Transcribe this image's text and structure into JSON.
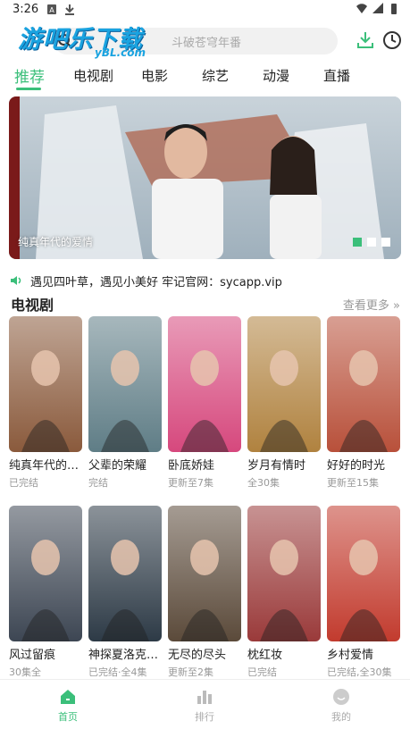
{
  "status_bar": {
    "time": "3:26"
  },
  "header": {
    "logo_text": "游吧乐下载",
    "logo_sub": "yBL.com",
    "search_placeholder": "斗破苍穹年番"
  },
  "tabs": [
    {
      "label": "推荐",
      "active": true
    },
    {
      "label": "电视剧"
    },
    {
      "label": "电影"
    },
    {
      "label": "综艺"
    },
    {
      "label": "动漫"
    },
    {
      "label": "直播"
    }
  ],
  "banner": {
    "caption": "纯真年代的爱情",
    "slide_count": 3,
    "active_slide": 1
  },
  "notice": {
    "text": "遇见四叶草，遇见小美好 牢记官网：sycapp.vip"
  },
  "section": {
    "title": "电视剧",
    "more_label": "查看更多"
  },
  "cards": [
    {
      "title": "纯真年代的爱情",
      "status": "已完结",
      "color": "#8a5a3c"
    },
    {
      "title": "父辈的荣耀",
      "status": "完结",
      "color": "#5f7d86"
    },
    {
      "title": "卧底娇娃",
      "status": "更新至7集",
      "color": "#d6487d"
    },
    {
      "title": "岁月有情时",
      "status": "全30集",
      "color": "#b0823f"
    },
    {
      "title": "好好的时光",
      "status": "更新至15集",
      "color": "#b8503a"
    },
    {
      "title": "风过留痕",
      "status": "30集全",
      "color": "#3d4653"
    },
    {
      "title": "神探夏洛克第一季",
      "status": "已完结·全4集",
      "color": "#2d3a46"
    },
    {
      "title": "无尽的尽头",
      "status": "更新至2集",
      "color": "#5b4a3a"
    },
    {
      "title": "枕红妆",
      "status": "已完结",
      "color": "#9a3a3a"
    },
    {
      "title": "乡村爱情",
      "status": "已完结,全30集",
      "color": "#c23b2e"
    }
  ],
  "bottom_nav": [
    {
      "label": "首页",
      "icon": "home-icon",
      "active": true
    },
    {
      "label": "排行",
      "icon": "ranking-icon"
    },
    {
      "label": "我的",
      "icon": "profile-icon"
    }
  ],
  "colors": {
    "accent": "#3bbf7a",
    "logo": "#1aa3e0"
  }
}
